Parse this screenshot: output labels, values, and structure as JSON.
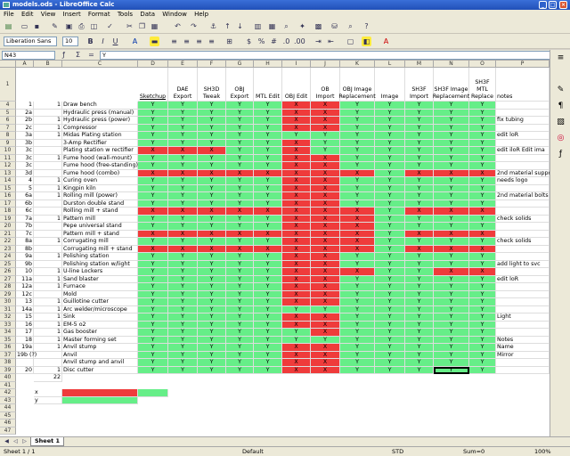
{
  "window": {
    "title": "models.ods - LibreOffice Calc"
  },
  "menu": [
    "File",
    "Edit",
    "View",
    "Insert",
    "Format",
    "Tools",
    "Data",
    "Window",
    "Help"
  ],
  "toolbar": {
    "font_name": "Liberation Sans",
    "font_size": "10"
  },
  "formula": {
    "cell_ref": "N43",
    "content": "Y"
  },
  "columns": [
    "A",
    "B",
    "C",
    "D",
    "E",
    "F",
    "G",
    "H",
    "I",
    "J",
    "K",
    "L",
    "M",
    "N",
    "O",
    "P"
  ],
  "headers": [
    "Sketchup",
    "DAE Export",
    "SH3D Tweak",
    "OBJ Export",
    "MTL Edit",
    "OBJ Edit",
    "OB Import",
    "OBJ Image Replacement",
    "Image",
    "SH3F Import",
    "SH3F Image Replacement",
    "SH3F MTL Replace",
    "notes"
  ],
  "row_numbers": [
    "1",
    "4",
    "5",
    "6",
    "7",
    "8",
    "9",
    "10",
    "11",
    "12",
    "13",
    "14",
    "15",
    "16",
    "17",
    "18",
    "19",
    "20",
    "21",
    "22",
    "23",
    "24",
    "25",
    "26",
    "27",
    "28",
    "29",
    "30",
    "31",
    "32",
    "33",
    "34",
    "35",
    "36",
    "37",
    "38",
    "39",
    "40",
    "41",
    "42",
    "43",
    "44",
    "45",
    "46",
    "47"
  ],
  "rows": [
    {
      "a": "1",
      "b": "1",
      "c": "Draw bench",
      "f": "GGGGGRRGGGGG",
      "p": ""
    },
    {
      "a": "2a",
      "b": "",
      "c": "Hydraulic press (manual)",
      "f": "GGGGGRRGGGGG",
      "p": ""
    },
    {
      "a": "2b",
      "b": "1",
      "c": "Hydraulic press (power)",
      "f": "GGGGGRRGGGGG",
      "p": "fix tubing"
    },
    {
      "a": "2c",
      "b": "1",
      "c": "Compressor",
      "f": "GGGGGRRGGGGG",
      "p": ""
    },
    {
      "a": "3a",
      "b": "1",
      "c": "Midas Plating station",
      "f": "GGGGGGGGGGGG",
      "p": "edit loR"
    },
    {
      "a": "3b",
      "b": "",
      "c": "3-Amp Rectifier",
      "f": "GGGGGRGGGGGG",
      "p": ""
    },
    {
      "a": "3c",
      "b": "",
      "c": "Plating station w rectifier",
      "f": "RRRGGRGGGGGG",
      "p": "edit iloR  Edit ima"
    },
    {
      "a": "3c",
      "b": "1",
      "c": "Fume hood (wall-mount)",
      "f": "GGGGGRRGGGGG",
      "p": ""
    },
    {
      "a": "3c",
      "b": "",
      "c": "Fume hood (free-standing)",
      "f": "GGGGGRRGGGGG",
      "p": ""
    },
    {
      "a": "3d",
      "b": "",
      "c": "Fume hood (combo)",
      "f": "RRRRRRRRGRRR",
      "p": "2nd material suppo"
    },
    {
      "a": "4",
      "b": "1",
      "c": "Curing oven",
      "f": "GGGGGRRGGGGG",
      "p": "needs logo"
    },
    {
      "a": "5",
      "b": "1",
      "c": "Kingpin kiln",
      "f": "GGGGGRRGGGGG",
      "p": ""
    },
    {
      "a": "6a",
      "b": "1",
      "c": "Rolling mill (power)",
      "f": "GGGGGRRGGGGG",
      "p": "2nd material bolts"
    },
    {
      "a": "6b",
      "b": "",
      "c": "Durston double stand",
      "f": "GGGGGRRGGGGG",
      "p": ""
    },
    {
      "a": "6c",
      "b": "",
      "c": "Rolling mill + stand",
      "f": "RRRRRRRRGRRR",
      "p": ""
    },
    {
      "a": "7a",
      "b": "1",
      "c": "Pattern mill",
      "f": "GGGGGRRRGGGG",
      "p": "check solids"
    },
    {
      "a": "7b",
      "b": "",
      "c": "Pepe universal stand",
      "f": "GGGGGRRRGGGG",
      "p": ""
    },
    {
      "a": "7c",
      "b": "",
      "c": "Pattern mill + stand",
      "f": "RRRRRRRRGRRR",
      "p": ""
    },
    {
      "a": "8a",
      "b": "1",
      "c": "Corrugating mill",
      "f": "GGGGGRRRGGGG",
      "p": "check solids"
    },
    {
      "a": "8b",
      "b": "",
      "c": "Corrugating mill + stand",
      "f": "RRRRRRRRGRRR",
      "p": ""
    },
    {
      "a": "9a",
      "b": "1",
      "c": "Polishing station",
      "f": "GGGGGRRGGGGG",
      "p": ""
    },
    {
      "a": "9b",
      "b": "",
      "c": "Polishing station w/light",
      "f": "GGGGGRRGGGGG",
      "p": "add light to svc"
    },
    {
      "a": "10",
      "b": "1",
      "c": "U-line Lockers",
      "f": "GGGGGRRRGGRR",
      "p": ""
    },
    {
      "a": "11a",
      "b": "1",
      "c": "Sand blaster",
      "f": "GGGGGRRGGGGG",
      "p": "edit loR"
    },
    {
      "a": "12a",
      "b": "1",
      "c": "Furnace",
      "f": "GGGGGRRGGGGG",
      "p": ""
    },
    {
      "a": "12c",
      "b": "",
      "c": "Mold",
      "f": "GGGGGRRGGGGG",
      "p": ""
    },
    {
      "a": "13",
      "b": "1",
      "c": "Guillotine cutter",
      "f": "GGGGGRRGGGGG",
      "p": ""
    },
    {
      "a": "14a",
      "b": "1",
      "c": "Arc welder/microscope",
      "f": "GGGGGGGGGGGG",
      "p": ""
    },
    {
      "a": "15",
      "b": "1",
      "c": "Sink",
      "f": "GGGGGRRGGGGG",
      "p": "Light"
    },
    {
      "a": "16",
      "b": "1",
      "c": "EM-5  o2",
      "f": "GGGGGRRGGGGG",
      "p": ""
    },
    {
      "a": "17",
      "b": "1",
      "c": "Gas booster",
      "f": "GGGGGGRGGGGG",
      "p": ""
    },
    {
      "a": "18",
      "b": "1",
      "c": "Master forming set",
      "f": "GGGGGGGGGGGG",
      "p": "Notes"
    },
    {
      "a": "19a",
      "b": "1",
      "c": "Anvil stump",
      "f": "GGGGGRRGGGGG",
      "p": "Name"
    },
    {
      "a": "19b (?)",
      "b": "",
      "c": "Anvil",
      "f": "GGGGGRRGGGGG",
      "p": "Mirror"
    },
    {
      "a": "",
      "b": "",
      "c": "Anvil stump and anvil",
      "f": "GGGGGRRGGGGG",
      "p": ""
    },
    {
      "a": "20",
      "b": "1",
      "c": "Disc cutter",
      "f": "GGGGGRRGGGGG",
      "p": ""
    }
  ],
  "total_b": "22",
  "legend": [
    {
      "label": "x",
      "color": "#ef3b3b"
    },
    {
      "label": "y",
      "color": "#66ee88"
    }
  ],
  "cell_value_green": "Y",
  "cell_value_red": "X",
  "sheet_tab": "Sheet 1",
  "status": {
    "sheet": "Sheet 1 / 1",
    "style": "Default",
    "std": "STD",
    "sum": "Sum=0",
    "zoom": "100%"
  },
  "colors": {
    "green": "#66ee88",
    "red": "#ef3b3b"
  }
}
